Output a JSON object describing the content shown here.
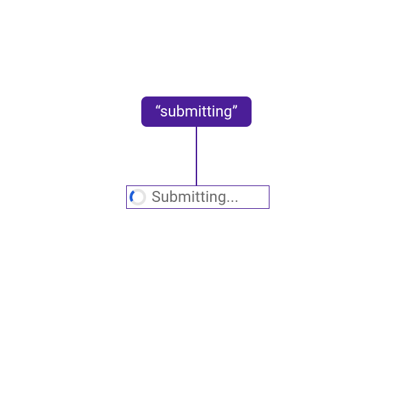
{
  "colors": {
    "nodeFill": "#4b1e98",
    "nodeText": "#ffffff",
    "spinnerTrack": "#e5e5e5",
    "spinnerArc": "#1f5fd8",
    "previewText": "#6b6b6b"
  },
  "stateNode": {
    "label": "“submitting”"
  },
  "previewBox": {
    "text": "Submitting..."
  }
}
